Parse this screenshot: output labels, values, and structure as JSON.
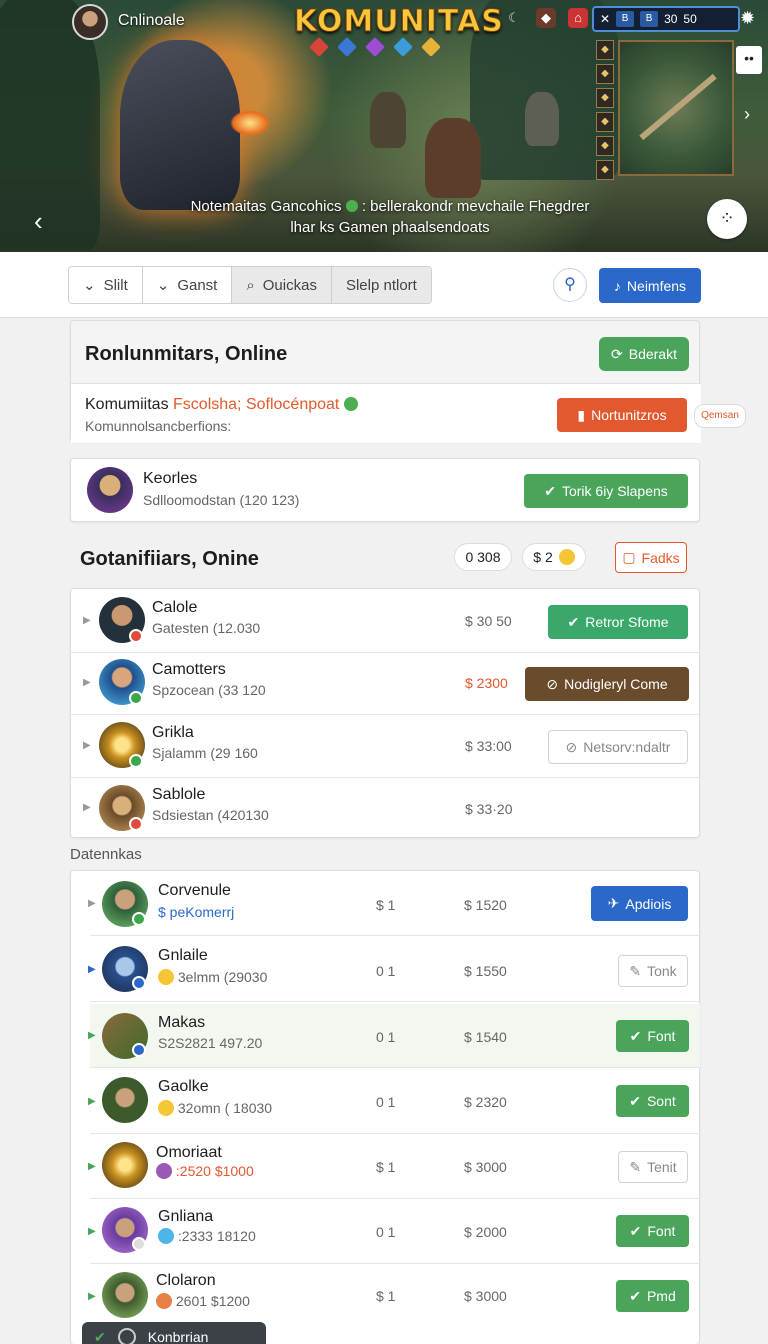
{
  "banner": {
    "user_name": "Cnlinoale",
    "game_title": "KOMUNITAS",
    "caption_line1": "Notemaitas Gancohics",
    "caption_line1_rest": ": bellerakondr mevchaile Fhegdrer",
    "caption_line2": "lhar ks Gamen phaalsendoats",
    "hud_labels": [
      "B",
      "B",
      "30",
      "50"
    ],
    "skills": [
      "◆",
      "◆",
      "◆",
      "◆",
      "◆",
      "◆"
    ]
  },
  "toolbar": {
    "segments": [
      "Slilt",
      "Ganst",
      "Ouickas",
      "Slelp ntlort"
    ],
    "new_button": "Neimfens"
  },
  "online_panel": {
    "title": "Ronlunmitars, Online",
    "refresh_button": "Bderakt",
    "sub_title": "Komumiitas",
    "sub_title_highlight": "Fscolsha; Soflocénpoat",
    "sub_text": "Komunnolsancberfions:",
    "action_button": "Nortunitzros",
    "side_tag": "Qemsan"
  },
  "profile_card": {
    "name": "Keorles",
    "sub": "Sdlloomodstan (120 123)",
    "button": "Torik 6iy Slapens"
  },
  "contributors": {
    "title": "Gotanifiiars, Onine",
    "counter_a": "0 308",
    "counter_b": "$ 2",
    "tools_button": "Fadks",
    "rows": [
      {
        "name": "Calole",
        "sub": "Gatesten (12.030",
        "amount": "$ 30 50",
        "button": "Retror Sfome",
        "badge": "#e14b3b"
      },
      {
        "name": "Camotters",
        "sub": "Spzocean (33 120",
        "amount": "$ 2300",
        "button": "Nodigleryl Come",
        "badge": "#3ba84a"
      },
      {
        "name": "Grikla",
        "sub": "Sjalamm (29 160",
        "amount": "$ 33:00",
        "button": "Netsorv:ndaltr",
        "badge": "#3ba84a"
      },
      {
        "name": "Sablole",
        "sub": "Sdsiestan (420130",
        "amount": "$ 33·20",
        "button": "",
        "badge": "#e14b3b"
      }
    ]
  },
  "datenkas": {
    "label": "Datennkas",
    "rows": [
      {
        "name": "Corvenule",
        "sub": "$ peKomerrj",
        "col1": "$ 1",
        "amount": "$ 1520",
        "button": "Apdiois",
        "style": "blue"
      },
      {
        "name": "Gnlaile",
        "sub": "3elmm (29030",
        "col1": "0 1",
        "amount": "$ 1550",
        "button": "Tonk",
        "style": "outline"
      },
      {
        "name": "Makas",
        "sub": "S2S2821 497.20",
        "col1": "0 1",
        "amount": "$ 1540",
        "button": "Font",
        "style": "green"
      },
      {
        "name": "Gaolke",
        "sub": "32omn ( 18030",
        "col1": "0 1",
        "amount": "$ 2320",
        "button": "Sont",
        "style": "green"
      },
      {
        "name": "Omoriaat",
        "sub": ":2520 $1000",
        "col1": "$ 1",
        "amount": "$ 3000",
        "button": "Tenit",
        "style": "outline"
      },
      {
        "name": "Gnliana",
        "sub": ":2333 18120",
        "col1": "0 1",
        "amount": "$ 2000",
        "button": "Font",
        "style": "green"
      },
      {
        "name": "Clolaron",
        "sub": "2601 $1200",
        "col1": "$ 1",
        "amount": "$ 3000",
        "button": "Pmd",
        "style": "green"
      }
    ]
  },
  "footer": {
    "label": "Konbrrian"
  }
}
